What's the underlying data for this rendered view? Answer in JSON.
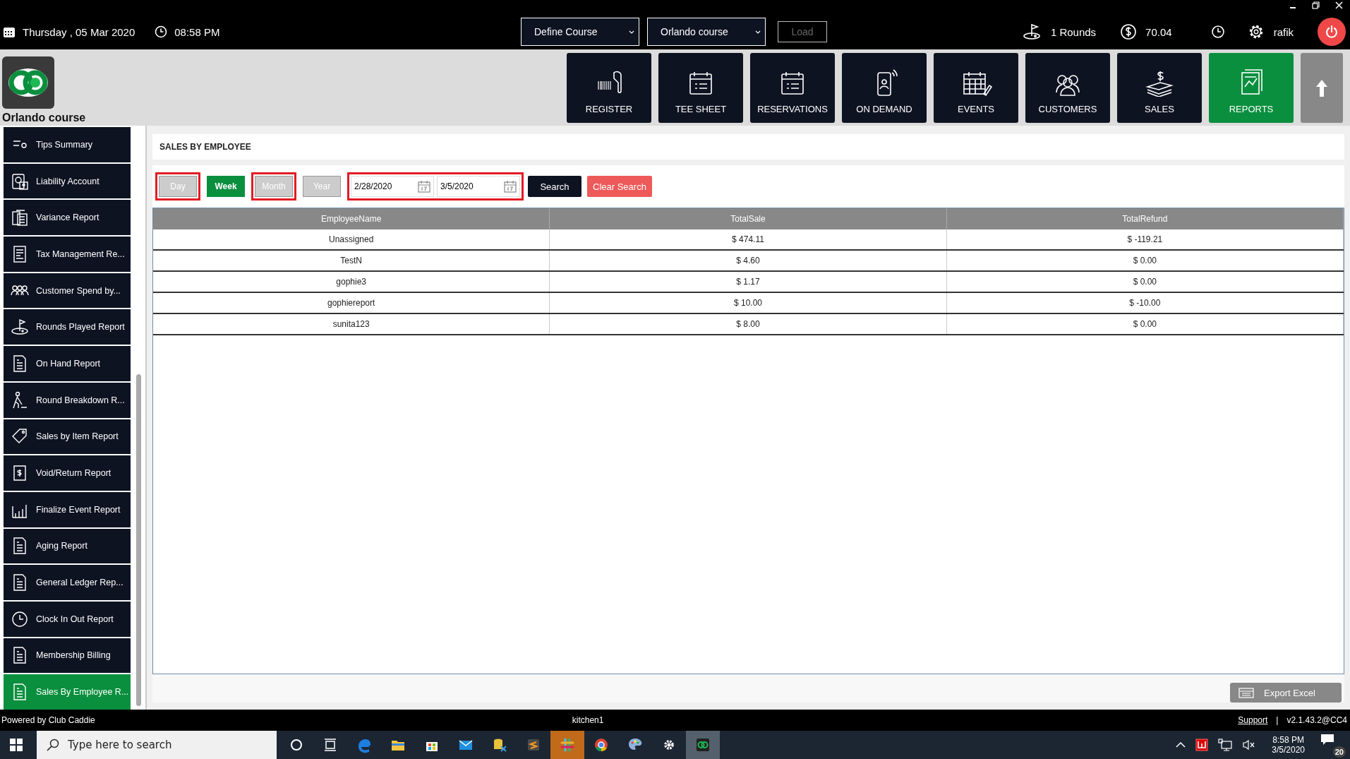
{
  "top_bar": {
    "date": "Thursday ,  05 Mar 2020",
    "time": "08:58 PM",
    "course_select": "Define Course",
    "course_value": "Orlando course",
    "load_button": "Load",
    "rounds": "1 Rounds",
    "balance": "70.04",
    "user": "rafik"
  },
  "brand": {
    "name": "Orlando course"
  },
  "nav": [
    {
      "label": "REGISTER",
      "kind": "register",
      "selected": false
    },
    {
      "label": "TEE SHEET",
      "kind": "calendar",
      "selected": false
    },
    {
      "label": "RESERVATIONS",
      "kind": "calendar",
      "selected": false
    },
    {
      "label": "ON DEMAND",
      "kind": "phone",
      "selected": false
    },
    {
      "label": "EVENTS",
      "kind": "events",
      "selected": false
    },
    {
      "label": "CUSTOMERS",
      "kind": "people",
      "selected": false
    },
    {
      "label": "SALES",
      "kind": "money",
      "selected": false
    },
    {
      "label": "REPORTS",
      "kind": "report",
      "selected": true
    }
  ],
  "sidebar": {
    "items": [
      {
        "label": "Tips Summary",
        "kind": "list",
        "selected": false
      },
      {
        "label": "Liability Account",
        "kind": "safe",
        "selected": false
      },
      {
        "label": "Variance Report",
        "kind": "calc",
        "selected": false
      },
      {
        "label": "Tax Management Re...",
        "kind": "tax",
        "selected": false
      },
      {
        "label": "Customer Spend by...",
        "kind": "people",
        "selected": false
      },
      {
        "label": "Rounds Played Report",
        "kind": "golf",
        "selected": false
      },
      {
        "label": "On Hand Report",
        "kind": "doc",
        "selected": false
      },
      {
        "label": "Round Breakdown R...",
        "kind": "golfer",
        "selected": false
      },
      {
        "label": "Sales by Item Report",
        "kind": "tag",
        "selected": false
      },
      {
        "label": "Void/Return Report",
        "kind": "refund",
        "selected": false
      },
      {
        "label": "Finalize Event Report",
        "kind": "bars",
        "selected": false
      },
      {
        "label": "Aging Report",
        "kind": "doc",
        "selected": false
      },
      {
        "label": "General Ledger Rep...",
        "kind": "doc",
        "selected": false
      },
      {
        "label": "Clock In Out Report",
        "kind": "clock",
        "selected": false
      },
      {
        "label": "Membership Billing",
        "kind": "doc",
        "selected": false
      },
      {
        "label": "Sales By Employee R...",
        "kind": "doc",
        "selected": true
      }
    ]
  },
  "report": {
    "title": "SALES BY EMPLOYEE",
    "periods": [
      {
        "label": "Day",
        "selected": false,
        "highlighted": true
      },
      {
        "label": "Week",
        "selected": true,
        "highlighted": false
      },
      {
        "label": "Month",
        "selected": false,
        "highlighted": true
      },
      {
        "label": "Year",
        "selected": false,
        "highlighted": false
      }
    ],
    "date_from": "2/28/2020",
    "date_to": "3/5/2020",
    "dates_highlighted": true,
    "search_button": "Search",
    "clear_button": "Clear Search",
    "table": {
      "columns": [
        "EmployeeName",
        "TotalSale",
        "TotalRefund"
      ],
      "rows": [
        [
          "Unassigned",
          "$ 474.11",
          "$ -119.21"
        ],
        [
          "TestN",
          "$ 4.60",
          "$ 0.00"
        ],
        [
          "gophie3",
          "$ 1.17",
          "$ 0.00"
        ],
        [
          "gophiereport",
          "$ 10.00",
          "$ -10.00"
        ],
        [
          "sunita123",
          "$ 8.00",
          "$ 0.00"
        ]
      ]
    },
    "export_button": "Export Excel"
  },
  "footer": {
    "powered": "Powered by Club Caddie",
    "station": "kitchen1",
    "support": "Support",
    "separator": "|",
    "version": "v2.1.43.2@CC4"
  },
  "taskbar": {
    "search_placeholder": "Type here to search",
    "time": "8:58 PM",
    "date": "3/5/2020",
    "notifications": "20",
    "apps": [
      {
        "kind": "circle",
        "active": false,
        "flashing": false
      },
      {
        "kind": "taskview",
        "active": false,
        "flashing": false
      },
      {
        "kind": "browser",
        "active": false,
        "flashing": false
      },
      {
        "kind": "folder",
        "active": false,
        "flashing": false
      },
      {
        "kind": "store",
        "active": false,
        "flashing": false
      },
      {
        "kind": "mail",
        "active": false,
        "flashing": false
      },
      {
        "kind": "tool",
        "active": false,
        "flashing": false
      },
      {
        "kind": "editor",
        "active": false,
        "flashing": false
      },
      {
        "kind": "chat",
        "active": false,
        "flashing": true
      },
      {
        "kind": "chrome",
        "active": false,
        "flashing": false
      },
      {
        "kind": "paint",
        "active": false,
        "flashing": false
      },
      {
        "kind": "gear",
        "active": false,
        "flashing": false
      },
      {
        "kind": "logo",
        "active": true,
        "flashing": false
      }
    ]
  }
}
